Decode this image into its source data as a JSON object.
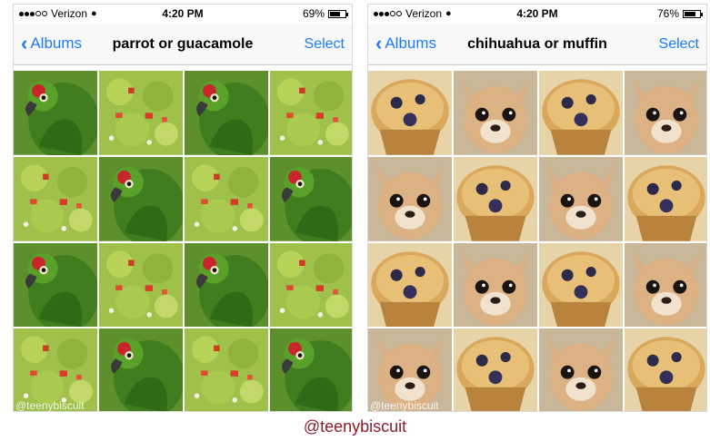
{
  "left": {
    "status": {
      "carrier": "Verizon",
      "time": "4:20 PM",
      "battery": "69%",
      "battery_level": 0.69
    },
    "nav": {
      "back_label": "Albums",
      "title": "parrot or guacamole",
      "select_label": "Select"
    },
    "tiles": [
      "parrot",
      "guac",
      "parrot",
      "guac",
      "guac",
      "parrot",
      "guac",
      "parrot",
      "parrot",
      "guac",
      "parrot",
      "guac",
      "guac",
      "parrot",
      "guac",
      "parrot"
    ],
    "watermark": "@teenybiscuit"
  },
  "right": {
    "status": {
      "carrier": "Verizon",
      "time": "4:20 PM",
      "battery": "76%",
      "battery_level": 0.76
    },
    "nav": {
      "back_label": "Albums",
      "title": "chihuahua or muffin",
      "select_label": "Select"
    },
    "tiles": [
      "muffin",
      "dog",
      "muffin",
      "dog",
      "dog",
      "muffin",
      "dog",
      "muffin",
      "muffin",
      "dog",
      "muffin",
      "dog",
      "dog",
      "muffin",
      "dog",
      "muffin"
    ],
    "watermark": "@teenybiscuit"
  },
  "caption": "@teenybiscuit",
  "colors": {
    "accent": "#1b7cf7",
    "caption": "#8b1d2c"
  }
}
